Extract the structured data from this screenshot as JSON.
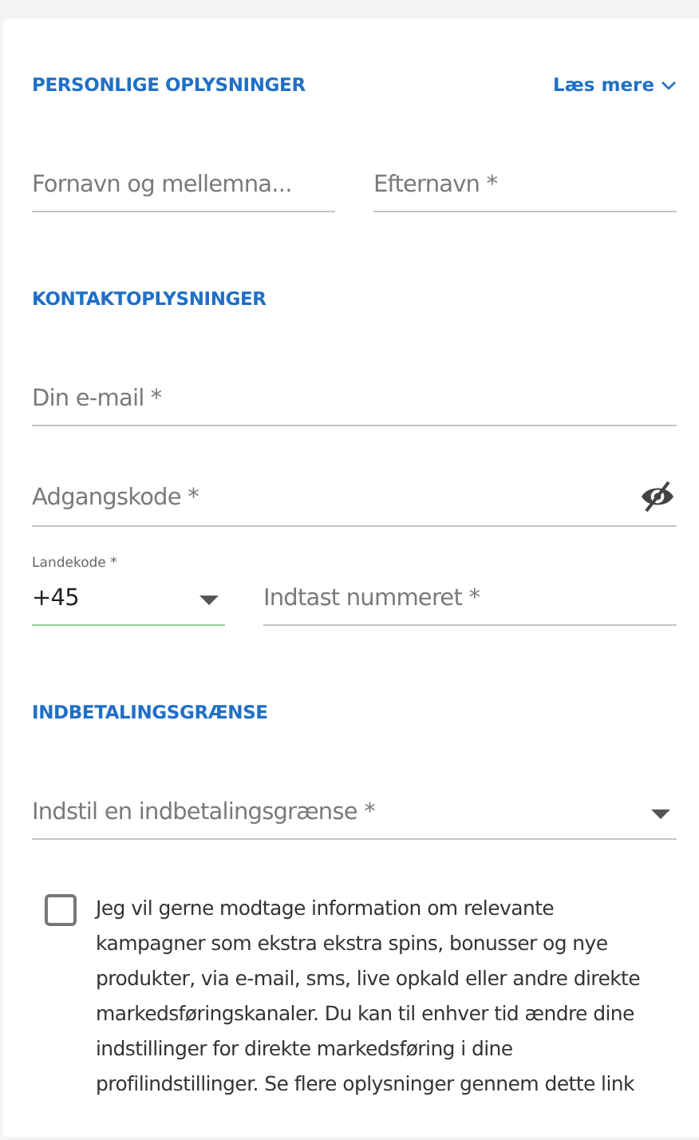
{
  "sections": [
    {
      "title": "PERSONLIGE OPLYSNINGER",
      "link": "Læs mere",
      "rows": [
        [
          {
            "kind": "text",
            "placeholder": "Fornavn og mellemna..."
          },
          {
            "kind": "text",
            "placeholder": "Efternavn *"
          }
        ]
      ]
    },
    {
      "title": "KONTAKTOPLYSNINGER",
      "rows": [
        [
          {
            "kind": "text",
            "placeholder": "Din e-mail *"
          }
        ],
        [
          {
            "kind": "password",
            "placeholder": "Adgangskode *"
          }
        ],
        [
          {
            "kind": "select",
            "label": "Landekode *",
            "value": "+45",
            "valid": true
          },
          {
            "kind": "text",
            "placeholder": "Indtast nummeret *"
          }
        ]
      ]
    },
    {
      "title": "INDBETALINGSGRÆNSE",
      "rows": [
        [
          {
            "kind": "select",
            "placeholder": "Indstil en indbetalingsgrænse *",
            "valid": false
          }
        ]
      ]
    }
  ],
  "consent": {
    "checked": false,
    "text": "Jeg vil gerne modtage information om relevante kampagner som ekstra ekstra spins, bonusser og nye produkter, via e-mail, sms, live opkald eller andre direkte markedsføringskanaler. Du kan til enhver tid ændre dine indstillinger for direkte markedsføring i dine profilindstillinger. Se flere oplysninger gennem dette link"
  }
}
